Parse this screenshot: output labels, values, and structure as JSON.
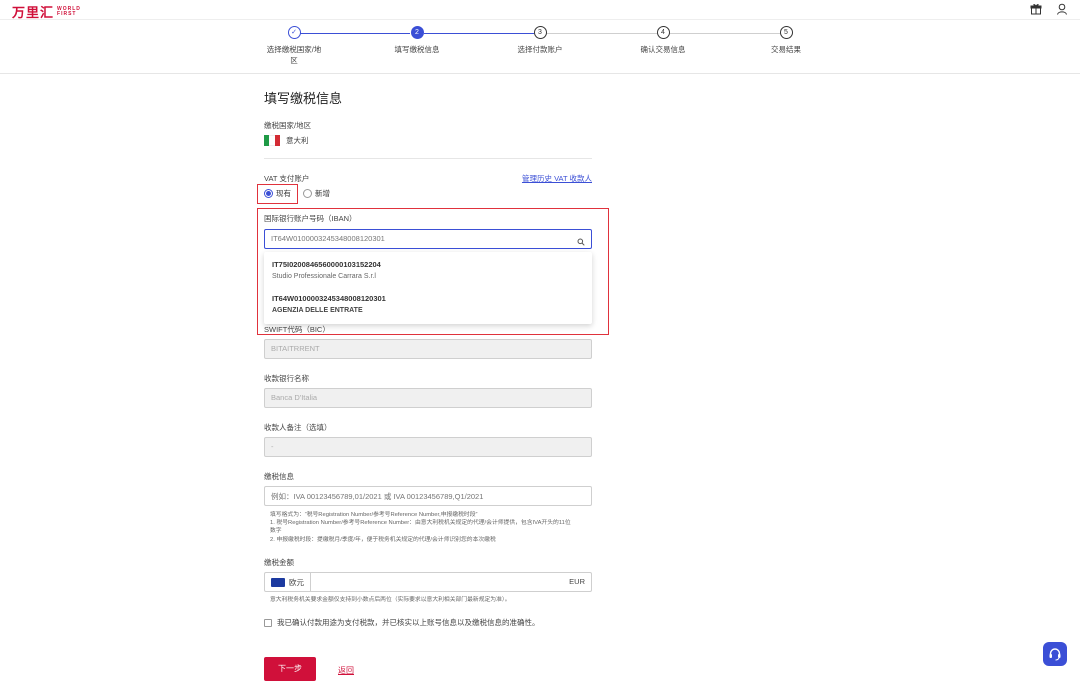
{
  "header": {
    "logo_cn": "万里汇",
    "logo_en_line1": "WORLD",
    "logo_en_line2": "FIRST",
    "gift_icon": "gift-icon",
    "user_icon": "user-icon"
  },
  "steps": [
    {
      "index": "1",
      "label": "选择缴税国家/地区",
      "state": "done"
    },
    {
      "index": "2",
      "label": "填写缴税信息",
      "state": "active"
    },
    {
      "index": "3",
      "label": "选择付款账户",
      "state": "todo"
    },
    {
      "index": "4",
      "label": "确认交易信息",
      "state": "todo"
    },
    {
      "index": "5",
      "label": "交易结果",
      "state": "todo"
    }
  ],
  "form": {
    "title": "填写缴税信息",
    "country_label": "缴税国家/地区",
    "country_value": "意大利",
    "vat_account_label": "VAT 支付账户",
    "manage_link": "管理历史 VAT 收款人",
    "radio_existing": "现有",
    "radio_new": "新增",
    "iban_label": "国际银行账户号码（IBAN）",
    "iban_value": "IT64W0100003245348008120301",
    "iban_options": [
      {
        "number": "IT75I0200846560000103152204",
        "name": "Studio Professionale Carrara S.r.l"
      },
      {
        "number": "IT64W0100003245348008120301",
        "name": "AGENZIA DELLE ENTRATE"
      }
    ],
    "swift_label": "SWIFT代码（BIC）",
    "swift_value": "BITAITRRENT",
    "bank_label": "收款银行名称",
    "bank_value": "Banca D'Italia",
    "remark_label": "收款人备注（选填）",
    "remark_value": "-",
    "tax_info_label": "缴税信息",
    "tax_info_placeholder": "例如：IVA 00123456789,01/2021 或 IVA 00123456789,Q1/2021",
    "help_lines": [
      "填写格式为：“税号Registration Number/参考号Reference Number,申报缴税时段”",
      "1. 税号Registration Number/参考号Reference Number：由意大利税机关规定的代理/会计师提供，包含IVA开头的11位",
      "数字",
      "2. 申报缴税时段：提缴税月/季度/年，便于税务机关规定的代理/会计师识别您的本次缴税"
    ],
    "amount_label": "缴税金额",
    "currency_name": "欧元",
    "currency_code": "EUR",
    "amount_note": "意大利税务机关要求金额仅支持到小数点后两位（实际要求以意大利相关部门最新规定为准）。",
    "confirm_text": "我已确认付款用途为支付税款，并已核实以上账号信息以及缴税信息的准确性。",
    "next_button": "下一步",
    "back_link": "返回"
  },
  "colors": {
    "brand": "#d0103a",
    "primary": "#3b4fd6",
    "highlight": "#e0323c"
  }
}
